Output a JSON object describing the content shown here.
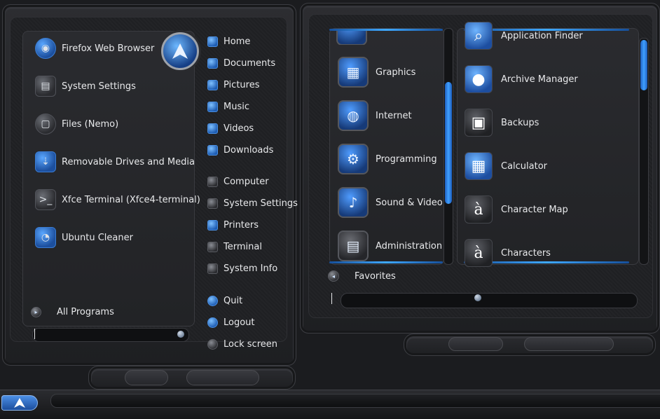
{
  "left_menu": {
    "pinned_apps": [
      {
        "label": "Firefox Web Browser",
        "icon": "firefox-icon",
        "glyph": "◉",
        "style": "blue round"
      },
      {
        "label": "System Settings",
        "icon": "settings-icon",
        "glyph": "▤",
        "style": ""
      },
      {
        "label": "Files (Nemo)",
        "icon": "files-icon",
        "glyph": "▢",
        "style": "round"
      },
      {
        "label": "Removable Drives and Media",
        "icon": "usb-icon",
        "glyph": "⇣",
        "style": "blue"
      },
      {
        "label": "Xfce Terminal (Xfce4-terminal)",
        "icon": "terminal-icon",
        "glyph": ">_",
        "style": ""
      },
      {
        "label": "Ubuntu Cleaner",
        "icon": "cleaner-icon",
        "glyph": "◔",
        "style": "blue"
      }
    ],
    "all_programs_label": "All Programs",
    "places": [
      {
        "label": "Home",
        "icon": "home-icon",
        "style": "blue"
      },
      {
        "label": "Documents",
        "icon": "documents-icon",
        "style": "blue"
      },
      {
        "label": "Pictures",
        "icon": "pictures-icon",
        "style": "blue"
      },
      {
        "label": "Music",
        "icon": "music-icon",
        "style": "blue"
      },
      {
        "label": "Videos",
        "icon": "videos-icon",
        "style": "blue"
      },
      {
        "label": "Downloads",
        "icon": "downloads-icon",
        "style": "blue"
      }
    ],
    "system": [
      {
        "label": "Computer",
        "icon": "computer-icon",
        "style": ""
      },
      {
        "label": "System Settings",
        "icon": "system-settings-icon",
        "style": ""
      },
      {
        "label": "Printers",
        "icon": "printer-icon",
        "style": "blue"
      },
      {
        "label": "Terminal",
        "icon": "terminal-small-icon",
        "style": ""
      },
      {
        "label": "System Info",
        "icon": "system-info-icon",
        "style": ""
      }
    ],
    "session": [
      {
        "label": "Quit",
        "icon": "power-icon",
        "style": "blue round"
      },
      {
        "label": "Logout",
        "icon": "logout-icon",
        "style": "blue round"
      },
      {
        "label": "Lock screen",
        "icon": "lock-icon",
        "style": "round"
      }
    ]
  },
  "right_menu": {
    "categories": [
      {
        "label": "Graphics",
        "icon": "graphics-icon",
        "glyph": "▦",
        "style": ""
      },
      {
        "label": "Internet",
        "icon": "internet-globe-icon",
        "glyph": "◍",
        "style": ""
      },
      {
        "label": "Programming",
        "icon": "programming-gear-icon",
        "glyph": "⚙",
        "style": ""
      },
      {
        "label": "Sound & Video",
        "icon": "sound-video-icon",
        "glyph": "♪",
        "style": ""
      },
      {
        "label": "Administration",
        "icon": "administration-icon",
        "glyph": "▤",
        "style": "grey"
      }
    ],
    "apps": [
      {
        "label": "Application Finder",
        "icon": "magnifier-icon",
        "glyph": "⌕",
        "style": "blue"
      },
      {
        "label": "Archive Manager",
        "icon": "archive-manager-icon",
        "glyph": "●",
        "style": "blue"
      },
      {
        "label": "Backups",
        "icon": "backups-icon",
        "glyph": "▣",
        "style": ""
      },
      {
        "label": "Calculator",
        "icon": "calculator-icon",
        "glyph": "▦",
        "style": "blue"
      },
      {
        "label": "Character Map",
        "icon": "character-map-icon",
        "glyph": "à",
        "style": ""
      },
      {
        "label": "Characters",
        "icon": "characters-icon",
        "glyph": "à",
        "style": ""
      }
    ],
    "favorites_label": "Favorites"
  },
  "taskbar": {
    "start_icon": "arch-start-icon"
  }
}
